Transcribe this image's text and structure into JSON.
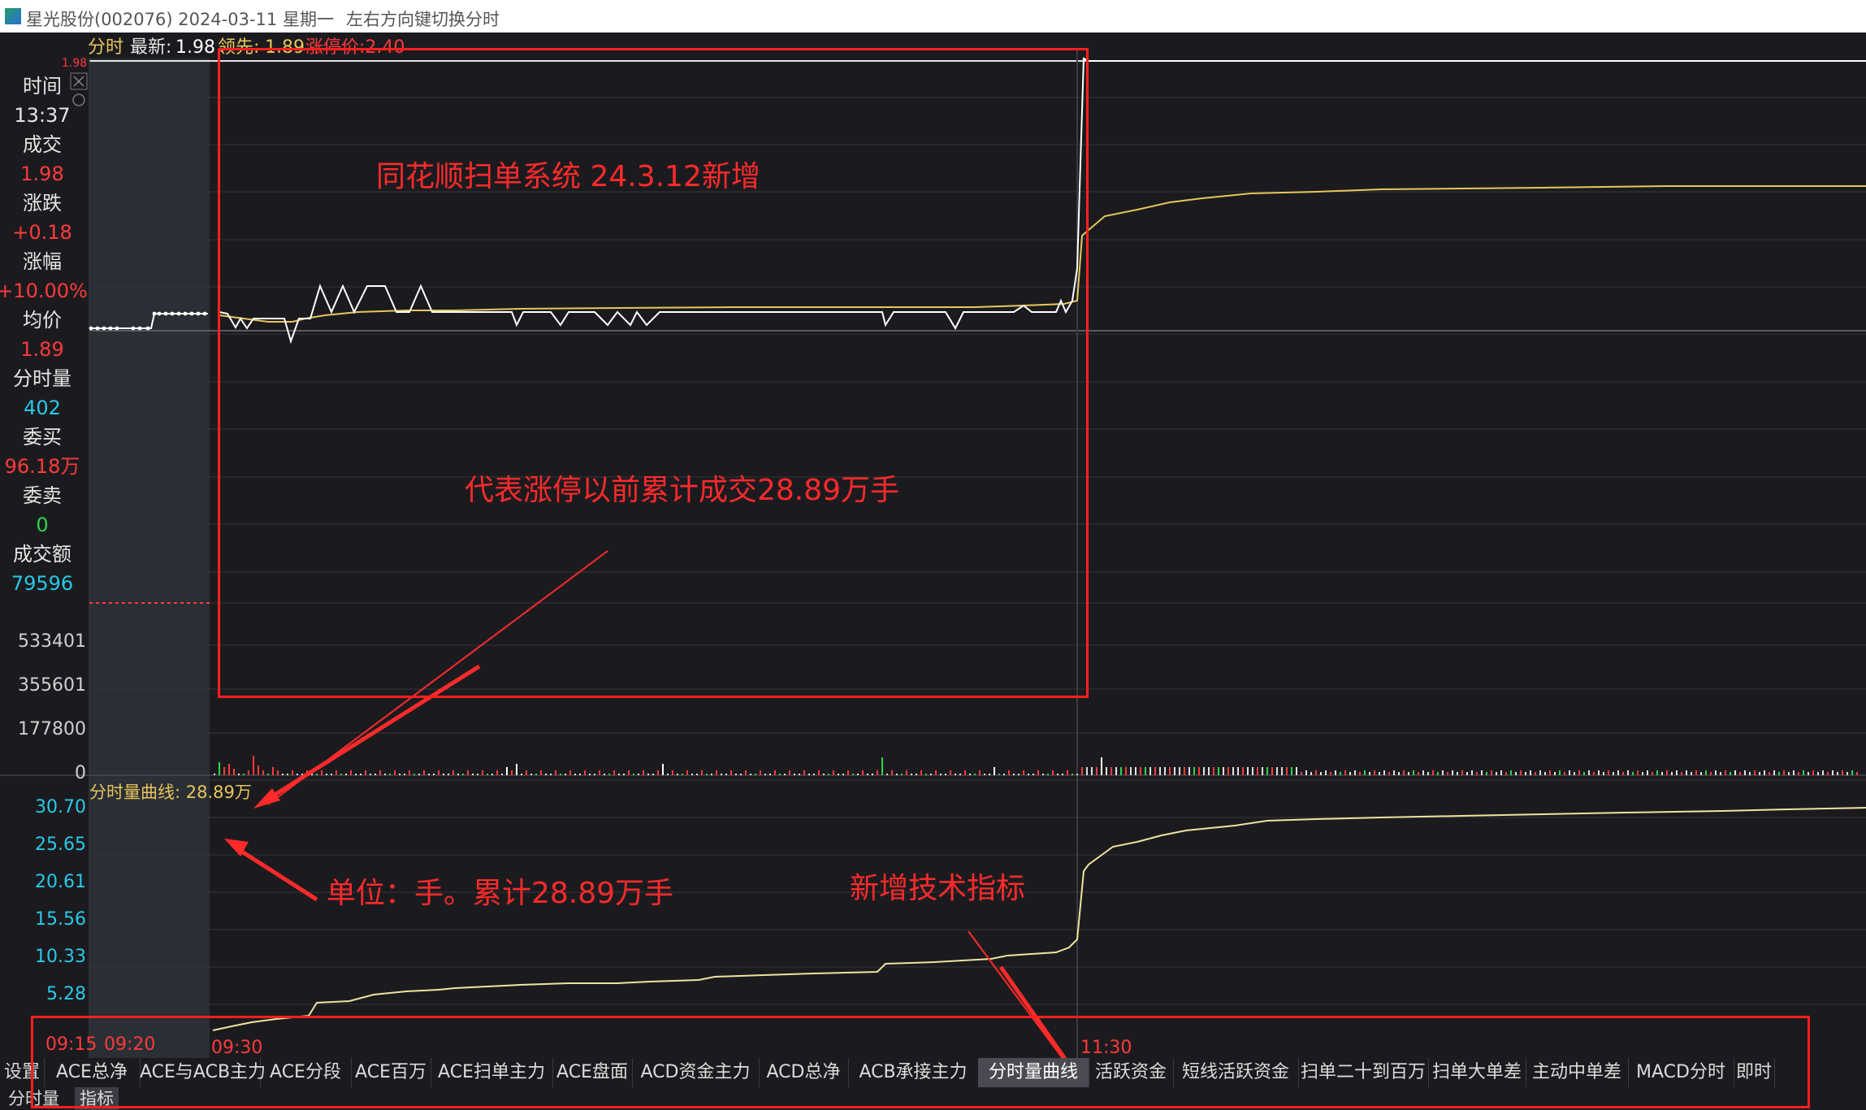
{
  "window": {
    "title": "星光股份(002076) 2024-03-11 星期一",
    "hint": "左右方向键切换分时"
  },
  "header": {
    "tab_label": "分时",
    "latest_label": "最新:",
    "latest_value": "1.98",
    "leading_label": "领先:",
    "leading_value": "1.89",
    "limit_text": "涨停价:2.40",
    "top_price": "1.98"
  },
  "sidebar": {
    "items": [
      {
        "label": "时间",
        "value": "13:37",
        "color": "#e6e6e6"
      },
      {
        "label": "成交",
        "value": "1.98",
        "color": "#ff3a3a"
      },
      {
        "label": "涨跌",
        "value": "+0.18",
        "color": "#ff3a3a"
      },
      {
        "label": "涨幅",
        "value": "+10.00%",
        "color": "#ff3a3a"
      },
      {
        "label": "均价",
        "value": "1.89",
        "color": "#ff3a3a"
      },
      {
        "label": "分时量",
        "value": "402",
        "color": "#29c8e8"
      },
      {
        "label": "委买",
        "value": "96.18万",
        "color": "#ff3a3a"
      },
      {
        "label": "委卖",
        "value": "0",
        "color": "#2bd64a"
      },
      {
        "label": "成交额",
        "value": "79596",
        "color": "#29c8e8"
      }
    ]
  },
  "volume_axis": [
    "533401",
    "355601",
    "177800",
    "0"
  ],
  "indicator": {
    "label": "分时量曲线: 28.89万",
    "axis": [
      "30.70",
      "25.65",
      "20.61",
      "15.56",
      "10.33",
      "5.28"
    ]
  },
  "time_axis": [
    "09:15",
    "09:20",
    "09:30",
    "11:30"
  ],
  "annotations": {
    "title": "同花顺扫单系统 24.3.12新增",
    "cumulative": "代表涨停以前累计成交28.89万手",
    "unit": "单位：手。累计28.89万手",
    "new_indicator": "新增技术指标"
  },
  "tabs": [
    {
      "label": "设置",
      "active": false
    },
    {
      "label": "ACE总净",
      "active": false
    },
    {
      "label": "ACE与ACB主力",
      "active": false
    },
    {
      "label": "ACE分段",
      "active": false
    },
    {
      "label": "ACE百万",
      "active": false
    },
    {
      "label": "ACE扫单主力",
      "active": false
    },
    {
      "label": "ACE盘面",
      "active": false
    },
    {
      "label": "ACD资金主力",
      "active": false
    },
    {
      "label": "ACD总净",
      "active": false
    },
    {
      "label": "ACB承接主力",
      "active": false
    },
    {
      "label": "分时量曲线",
      "active": true
    },
    {
      "label": "活跃资金",
      "active": false
    },
    {
      "label": "短线活跃资金",
      "active": false
    },
    {
      "label": "扫单二十到百万",
      "active": false
    },
    {
      "label": "扫单大单差",
      "active": false
    },
    {
      "label": "主动中单差",
      "active": false
    },
    {
      "label": "MACD分时",
      "active": false
    },
    {
      "label": "即时",
      "active": false
    }
  ],
  "subtabs": [
    {
      "label": "分时量",
      "active": false
    },
    {
      "label": "指标",
      "active": true
    }
  ],
  "colors": {
    "price_line": "#ffffff",
    "avg_line": "#e8c65a",
    "up": "#ff3a3a",
    "down": "#2bd64a",
    "annotation": "#ff2a2a",
    "panel_bg": "#1b1b1f",
    "preopen_bg": "#2a2e35"
  }
}
